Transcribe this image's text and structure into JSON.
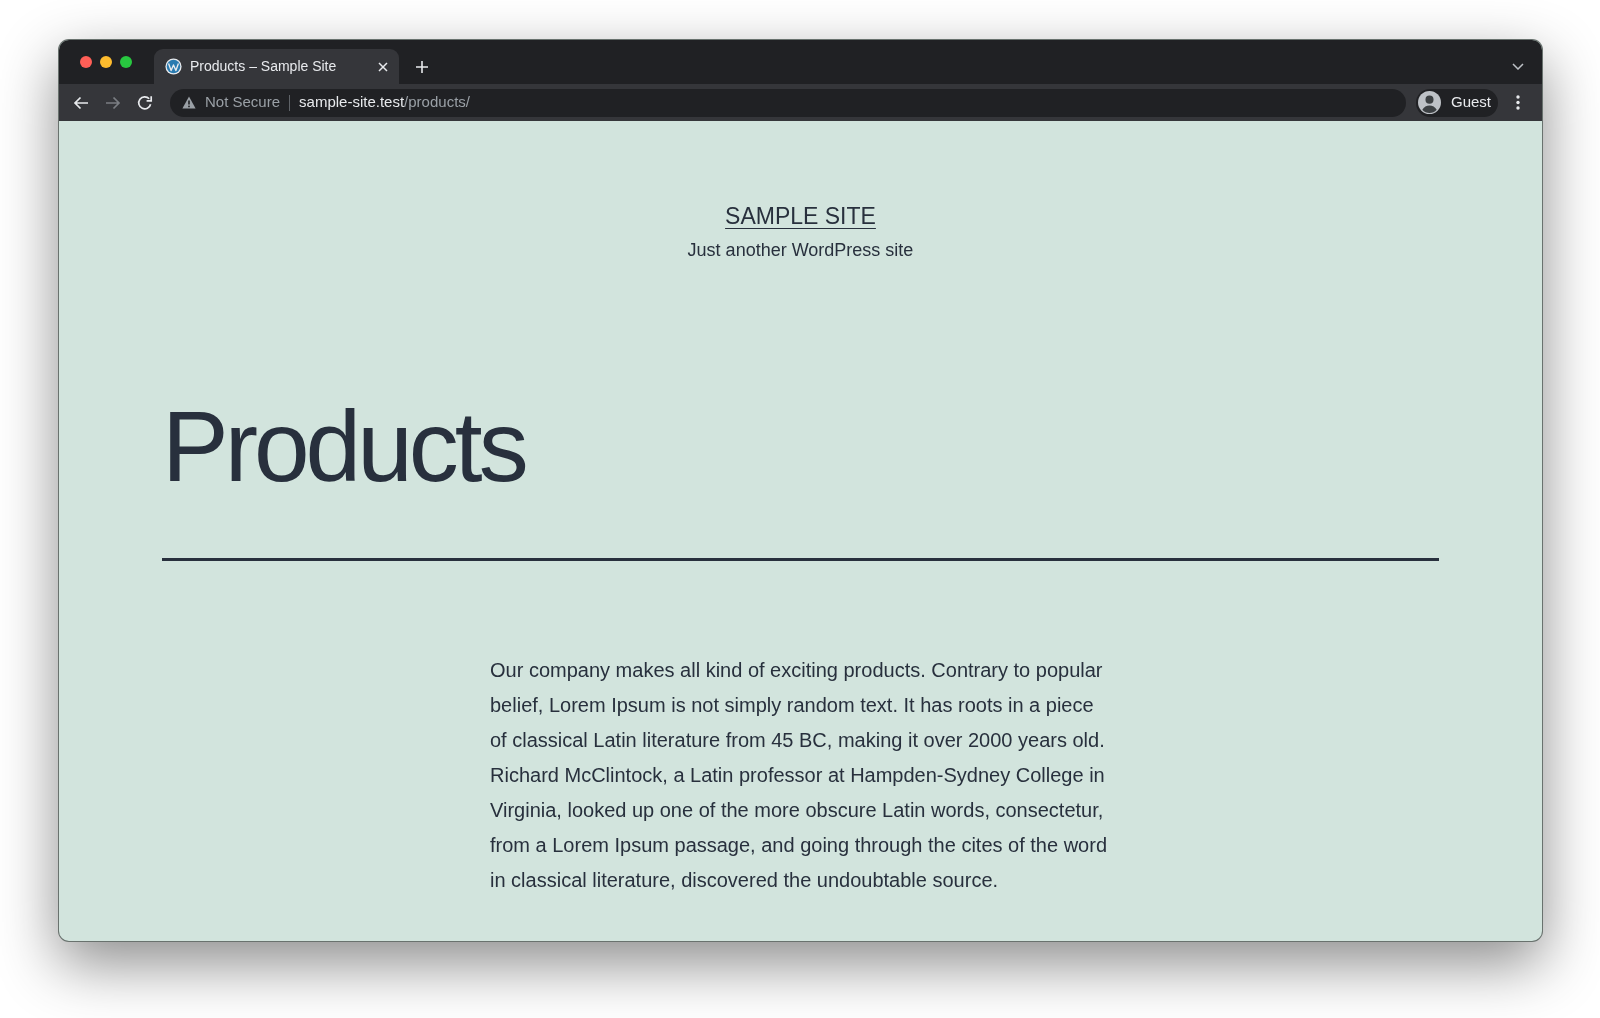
{
  "tabs": [
    {
      "title": "Products – Sample Site",
      "selected": true
    }
  ],
  "navigation": [
    {
      "kind": "back",
      "disabled": false
    },
    {
      "kind": "forward",
      "disabled": true
    },
    {
      "kind": "reload",
      "disabled": false
    }
  ],
  "address_bar": {
    "security": "Not Secure",
    "host": "sample-site.test",
    "path": "/products/"
  },
  "profile": {
    "label": "Guest"
  },
  "page": {
    "site_title": "SAMPLE SITE",
    "tagline": "Just another WordPress site",
    "heading": "Products",
    "paragraphs": [
      "Our company makes all kind of exciting products. Contrary to popular belief, Lorem Ipsum is not simply random text. It has roots in a piece of classical Latin literature from 45 BC, making it over 2000 years old. Richard McClintock, a Latin professor at Hampden-Sydney College in Virginia, looked up one of the more obscure Latin words, consectetur, from a Lorem Ipsum passage, and going through the cites of the word in classical literature, discovered the undoubtable source."
    ]
  }
}
